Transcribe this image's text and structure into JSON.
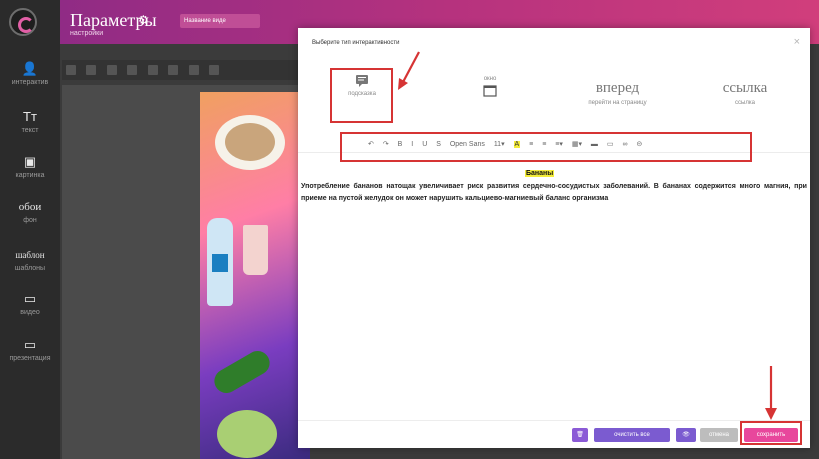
{
  "app": {
    "title": "Параметры",
    "subtitle": "настройки",
    "top_pill_label": "Название виде"
  },
  "sidebar": {
    "items": [
      {
        "icon": "person-icon",
        "glyph": "👤",
        "label": "интерактив"
      },
      {
        "icon": "text-icon",
        "glyph": "Tт",
        "label": "текст"
      },
      {
        "icon": "image-icon",
        "glyph": "▣",
        "label": "картинка"
      },
      {
        "icon": "wallpaper-icon",
        "glyph": "обои",
        "label": "фон"
      },
      {
        "icon": "template-icon",
        "glyph": "шаблон",
        "label": "шаблоны"
      },
      {
        "icon": "monitor-icon",
        "glyph": "▭",
        "label": "видео"
      },
      {
        "icon": "screen-icon",
        "glyph": "▭",
        "label": "презентация"
      }
    ]
  },
  "dialog": {
    "title": "Выберите тип интерактивности",
    "close_glyph": "×",
    "tabs": [
      {
        "name": "tooltip",
        "big": "",
        "label": "подсказка",
        "icon": "chat-bubble-icon"
      },
      {
        "name": "window",
        "big": "окно",
        "label": "",
        "icon": "window-icon"
      },
      {
        "name": "forward",
        "big": "вперед",
        "label": "перейти на страницу",
        "icon": ""
      },
      {
        "name": "link",
        "big": "ссылка",
        "label": "ссылка",
        "icon": ""
      }
    ],
    "toolbar": {
      "items": [
        "↶",
        "↷",
        "B",
        "I",
        "U",
        "S",
        "Open Sans",
        "11▾",
        "A",
        "≡",
        "≡",
        "≡▾",
        "▦▾",
        "▬",
        "▭",
        "∞",
        "⊝"
      ]
    },
    "content": {
      "heading": "Бананы",
      "body": "Употребление бананов натощак увеличивает риск развития сердечно-сосудистых заболеваний. В бананах содержится много магния, при приеме на пустой желудок он может нарушить кальциево-магниевый баланс организма"
    },
    "footer": {
      "delete_glyph": "🗑",
      "clear_label": "очистить все",
      "preview_glyph": "👁",
      "cancel_label": "отмена",
      "save_label": "сохранить"
    }
  },
  "colors": {
    "accent": "#c04e96",
    "annotation_red": "#d63434",
    "highlight": "#f3ec3a"
  }
}
